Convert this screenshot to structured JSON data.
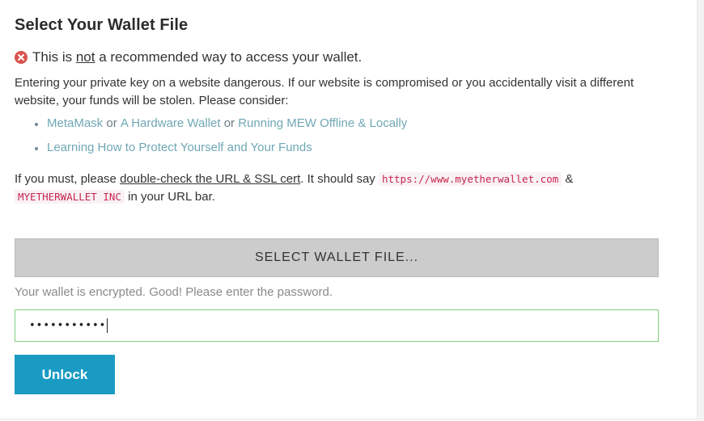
{
  "colors": {
    "accent_button": "#1a9bc4",
    "select_button_bg": "#cccccc",
    "link": "#6fa7b5",
    "code_text": "#c7254e",
    "code_bg": "#f9f2f4",
    "input_success_border": "#7fd07f",
    "warning_icon": "#d9534f"
  },
  "header": {
    "title": "Select Your Wallet File"
  },
  "warning": {
    "icon": "error-circle-x-icon",
    "prefix": "This is ",
    "emphasis": "not",
    "suffix": " a recommended way to access your wallet."
  },
  "intro": {
    "text": "Entering your private key on a website dangerous. If our website is compromised or you accidentally visit a different website, your funds will be stolen. Please consider:"
  },
  "options": {
    "item1": {
      "metamask": "MetaMask",
      "or1": " or ",
      "hardware": "A Hardware Wallet",
      "or2": " or ",
      "offline": "Running MEW Offline & Locally"
    },
    "item2": {
      "learn": "Learning How to Protect Yourself and Your Funds"
    }
  },
  "must": {
    "prefix": "If you must, please ",
    "link": "double-check the URL & SSL cert",
    "middle": ". It should say ",
    "url": "https://www.myetherwallet.com",
    "amp": " & ",
    "cert": "MYETHERWALLET INC",
    "suffix": " in your URL bar."
  },
  "wallet": {
    "select_label": "SELECT WALLET FILE...",
    "status": "Your wallet is encrypted. Good! Please enter the password.",
    "password_masked": "•••••••••••",
    "unlock_label": "Unlock"
  }
}
